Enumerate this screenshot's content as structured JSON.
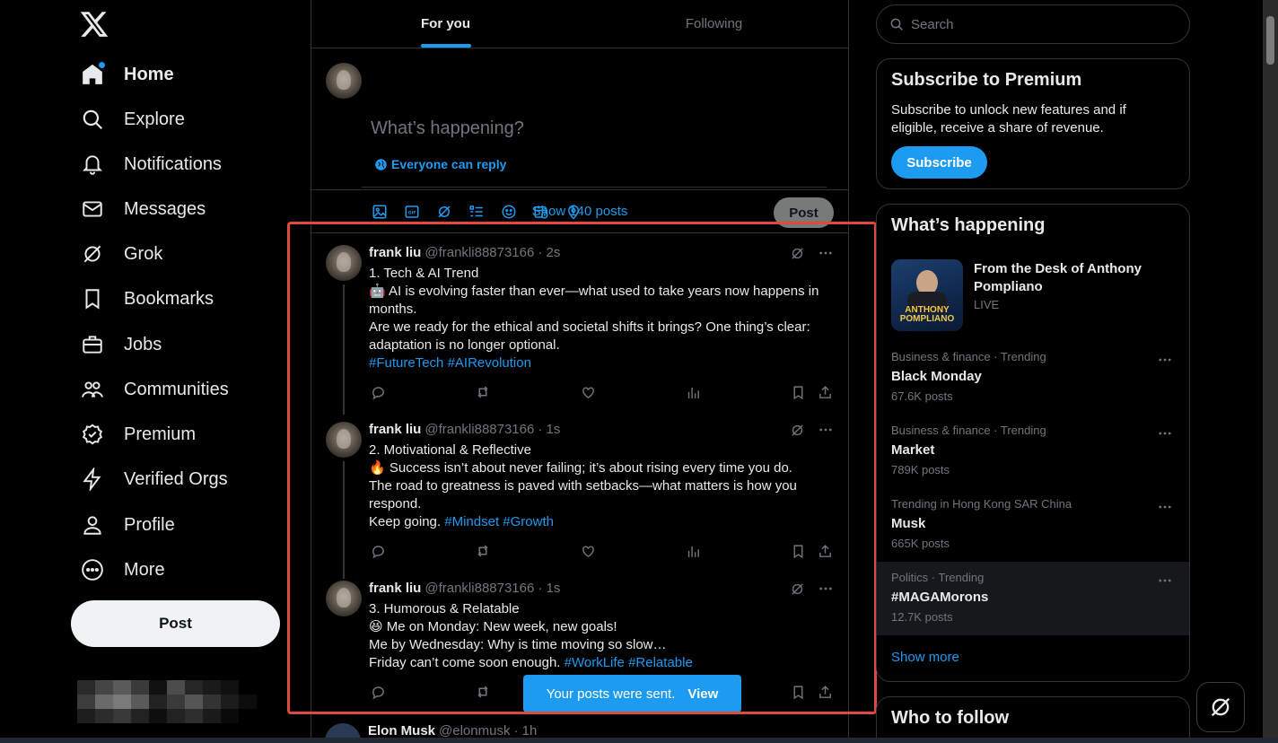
{
  "nav": {
    "items": [
      {
        "label": "Home",
        "icon": "home-icon"
      },
      {
        "label": "Explore",
        "icon": "search-icon"
      },
      {
        "label": "Notifications",
        "icon": "bell-icon"
      },
      {
        "label": "Messages",
        "icon": "mail-icon"
      },
      {
        "label": "Grok",
        "icon": "grok-icon"
      },
      {
        "label": "Bookmarks",
        "icon": "bookmark-icon"
      },
      {
        "label": "Jobs",
        "icon": "briefcase-icon"
      },
      {
        "label": "Communities",
        "icon": "people-icon"
      },
      {
        "label": "Premium",
        "icon": "verified-icon"
      },
      {
        "label": "Verified Orgs",
        "icon": "lightning-icon"
      },
      {
        "label": "Profile",
        "icon": "person-icon"
      },
      {
        "label": "More",
        "icon": "more-circle-icon"
      }
    ],
    "post_label": "Post"
  },
  "tabs": [
    "For you",
    "Following"
  ],
  "composer": {
    "placeholder": "What’s happening?",
    "reply_setting": "Everyone can reply",
    "post_label": "Post"
  },
  "show_posts": "Show 140 posts",
  "tweets": [
    {
      "name": "frank liu",
      "handle": "@frankli88873166",
      "time": "· 2s",
      "lines": [
        "1. Tech & AI Trend",
        "🤖 AI is evolving faster than ever—what used to take years now happens in months.",
        "Are we ready for the ethical and societal shifts it brings? One thing’s clear: adaptation is no longer optional."
      ],
      "hashtags": [
        "#FutureTech",
        "#AIRevolution"
      ]
    },
    {
      "name": "frank liu",
      "handle": "@frankli88873166",
      "time": "· 1s",
      "lines": [
        "2. Motivational & Reflective",
        "🔥 Success isn’t about never failing; it’s about rising every time you do.",
        "The road to greatness is paved with setbacks—what matters is how you respond.",
        "Keep going."
      ],
      "hashtags": [
        "#Mindset",
        "#Growth"
      ]
    },
    {
      "name": "frank liu",
      "handle": "@frankli88873166",
      "time": "· 1s",
      "lines": [
        "3. Humorous & Relatable",
        "😆 Me on Monday: New week, new goals!",
        "Me by Wednesday: Why is time moving so slow…",
        "Friday can’t come soon enough."
      ],
      "hashtags": [
        "#WorkLife",
        "#Relatable"
      ]
    }
  ],
  "peek": {
    "name": "Elon Musk",
    "handle": "@elonmusk",
    "time": "· 1h"
  },
  "toast": {
    "text": "Your posts were sent.",
    "action": "View"
  },
  "search": {
    "placeholder": "Search"
  },
  "premium": {
    "title": "Subscribe to Premium",
    "text": "Subscribe to unlock new features and if eligible, receive a share of revenue.",
    "button": "Subscribe"
  },
  "happening": {
    "title": "What’s happening",
    "featured": {
      "title": "From the Desk of Anthony Pompliano",
      "sub": "LIVE",
      "image_text": "ANTHONY POMPLIANO"
    },
    "trends": [
      {
        "category": "Business & finance · Trending",
        "name": "Black Monday",
        "count": "67.6K posts"
      },
      {
        "category": "Business & finance · Trending",
        "name": "Market",
        "count": "789K posts"
      },
      {
        "category": "Trending in Hong Kong SAR China",
        "name": "Musk",
        "count": "665K posts"
      },
      {
        "category": "Politics · Trending",
        "name": "#MAGAMorons",
        "count": "12.7K posts"
      }
    ],
    "show_more": "Show more"
  },
  "who_to_follow": "Who to follow",
  "colors": {
    "accent": "#1d9bf0",
    "highlight_box": "#e0493b",
    "background": "#000000"
  }
}
